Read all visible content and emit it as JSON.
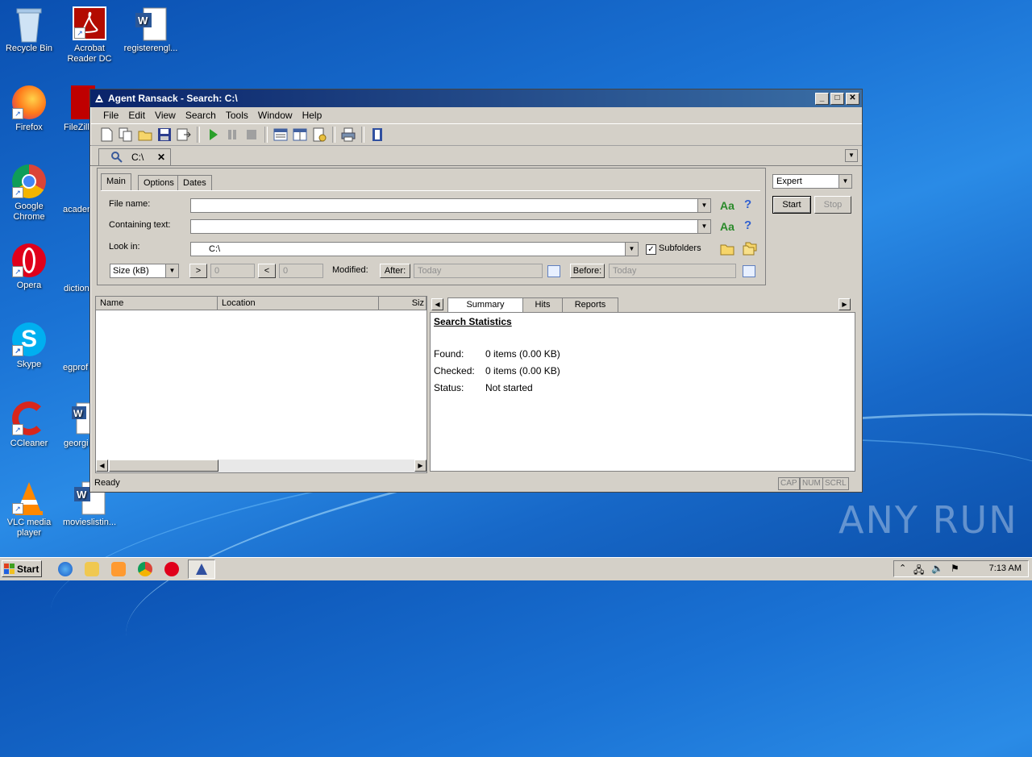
{
  "desktop": {
    "icons": [
      {
        "label": "Recycle Bin",
        "name": "recycle-bin-icon"
      },
      {
        "label": "Acrobat Reader DC",
        "name": "acrobat-reader-icon"
      },
      {
        "label": "registerengl...",
        "name": "word-document-icon"
      },
      {
        "label": "Firefox",
        "name": "firefox-icon"
      },
      {
        "label": "FileZilla",
        "name": "filezilla-icon"
      },
      {
        "label": "Google Chrome",
        "name": "chrome-icon"
      },
      {
        "label": "acaden",
        "name": "document-icon"
      },
      {
        "label": "Opera",
        "name": "opera-icon"
      },
      {
        "label": "diction",
        "name": "document-icon"
      },
      {
        "label": "Skype",
        "name": "skype-icon"
      },
      {
        "label": "egprof",
        "name": "document-icon"
      },
      {
        "label": "CCleaner",
        "name": "ccleaner-icon"
      },
      {
        "label": "georgi",
        "name": "word-document-icon"
      },
      {
        "label": "VLC media player",
        "name": "vlc-icon"
      },
      {
        "label": "movieslistin...",
        "name": "word-document-icon"
      }
    ],
    "watermark": "ANY RUN"
  },
  "window": {
    "title": "Agent Ransack - Search: C:\\",
    "menu": [
      "File",
      "Edit",
      "View",
      "Search",
      "Tools",
      "Window",
      "Help"
    ],
    "doc_tab": "C:\\",
    "mode": "Expert",
    "start_label": "Start",
    "stop_label": "Stop",
    "tabs": [
      "Main",
      "Options",
      "Dates"
    ],
    "file_name_label": "File name:",
    "containing_text_label": "Containing text:",
    "look_in_label": "Look in:",
    "look_in_value": "C:\\",
    "subfolders_label": "Subfolders",
    "aa_label": "Aa",
    "help_label": "?",
    "size_select": "Size (kB)",
    "gt_label": ">",
    "lt_label": "<",
    "size_min": "0",
    "size_max": "0",
    "modified_label": "Modified:",
    "after_label": "After:",
    "after_value": "Today",
    "before_label": "Before:",
    "before_value": "Today",
    "columns": [
      "Name",
      "Location",
      "Siz"
    ],
    "result_tabs": [
      "Summary",
      "Hits",
      "Reports"
    ],
    "stats": {
      "heading": "Search Statistics",
      "found_label": "Found:",
      "found_value": "0 items (0.00 KB)",
      "checked_label": "Checked:",
      "checked_value": "0 items (0.00 KB)",
      "status_label": "Status:",
      "status_value": "Not started"
    },
    "status": "Ready",
    "indicators": [
      "CAP",
      "NUM",
      "SCRL"
    ]
  },
  "taskbar": {
    "start_label": "Start",
    "clock": "7:13 AM"
  }
}
